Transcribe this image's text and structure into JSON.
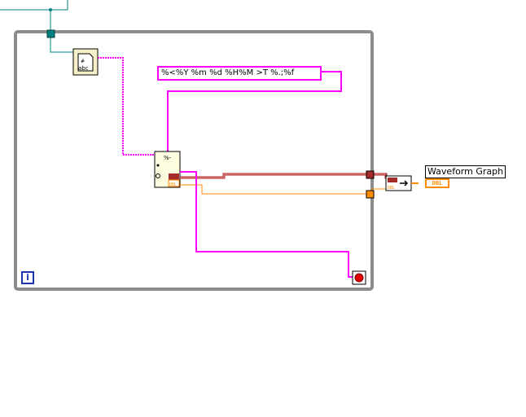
{
  "format_string": "%<%Y %m %d %H%M >T %.;%f",
  "graph": {
    "label": "Waveform Graph",
    "terminal_type": "DBL"
  },
  "function_node": {
    "top_text": "%-",
    "terminal_type": "DBL"
  },
  "while_loop": {
    "iteration_label": "i"
  },
  "icons": {
    "file_dialog": "file-dialog-icon",
    "scan_from_file": "read-spreadsheet-file-icon",
    "build_waveform": "build-waveform-icon",
    "stop": "stop-condition-icon"
  },
  "colors": {
    "string_wire": "#ff00ff",
    "dbl_wire": "#ff8c00",
    "error_wire": "#a52a2a",
    "path_wire": "#008080",
    "loop_frame": "#8c8c8c"
  }
}
